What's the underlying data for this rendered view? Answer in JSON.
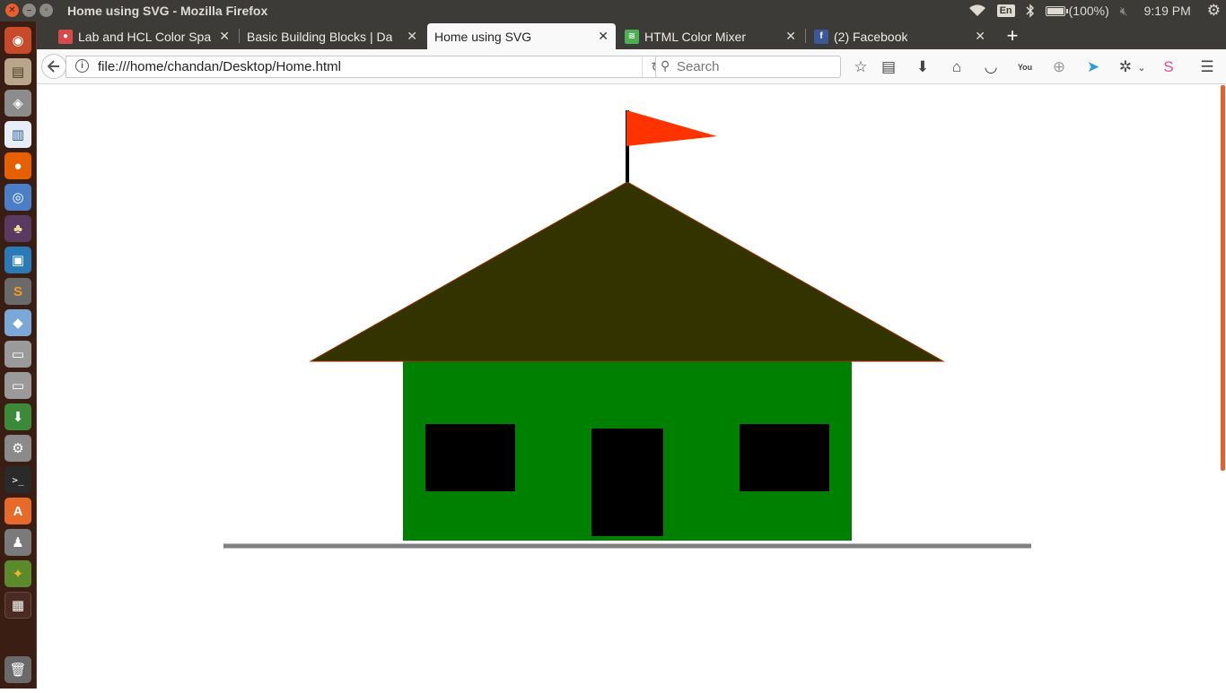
{
  "panel": {
    "window_title": "Home using SVG - Mozilla Firefox",
    "keyboard_layout": "En",
    "battery_text": "(100%)",
    "clock": "9:19 PM"
  },
  "launcher": {
    "icons": [
      "ubuntu-dash-icon",
      "files-icon",
      "system-monitor-icon",
      "libreoffice-writer-icon",
      "firefox-icon",
      "chromium-icon",
      "tor-browser-icon",
      "virtualbox-icon",
      "sublime-text-icon",
      "cube-app-icon",
      "disk-icon",
      "disk-icon-2",
      "download-manager-icon",
      "system-settings-icon",
      "terminal-icon",
      "software-center-icon",
      "remote-desktop-icon",
      "synaptic-icon",
      "workspace-switcher-icon",
      "trash-icon"
    ]
  },
  "tabs": [
    {
      "label": "Lab and HCL Color Spa",
      "active": false,
      "favicon_color": "#d84a4a"
    },
    {
      "label": "Basic Building Blocks | Da",
      "active": false,
      "favicon_color": ""
    },
    {
      "label": "Home using SVG",
      "active": true,
      "favicon_color": ""
    },
    {
      "label": "HTML Color Mixer",
      "active": false,
      "favicon_color": "#4caf50"
    },
    {
      "label": "(2) Facebook",
      "active": false,
      "favicon_color": "#3b5998"
    }
  ],
  "navbar": {
    "url": "file:///home/chandan/Desktop/Home.html",
    "search_placeholder": "Search"
  },
  "svg_colors": {
    "flag": "#ff3300",
    "pole": "#000000",
    "roof": "#333300",
    "roof_stroke": "#993300",
    "walls": "#008000",
    "window": "#000000",
    "door": "#000000",
    "ground": "#808080"
  }
}
